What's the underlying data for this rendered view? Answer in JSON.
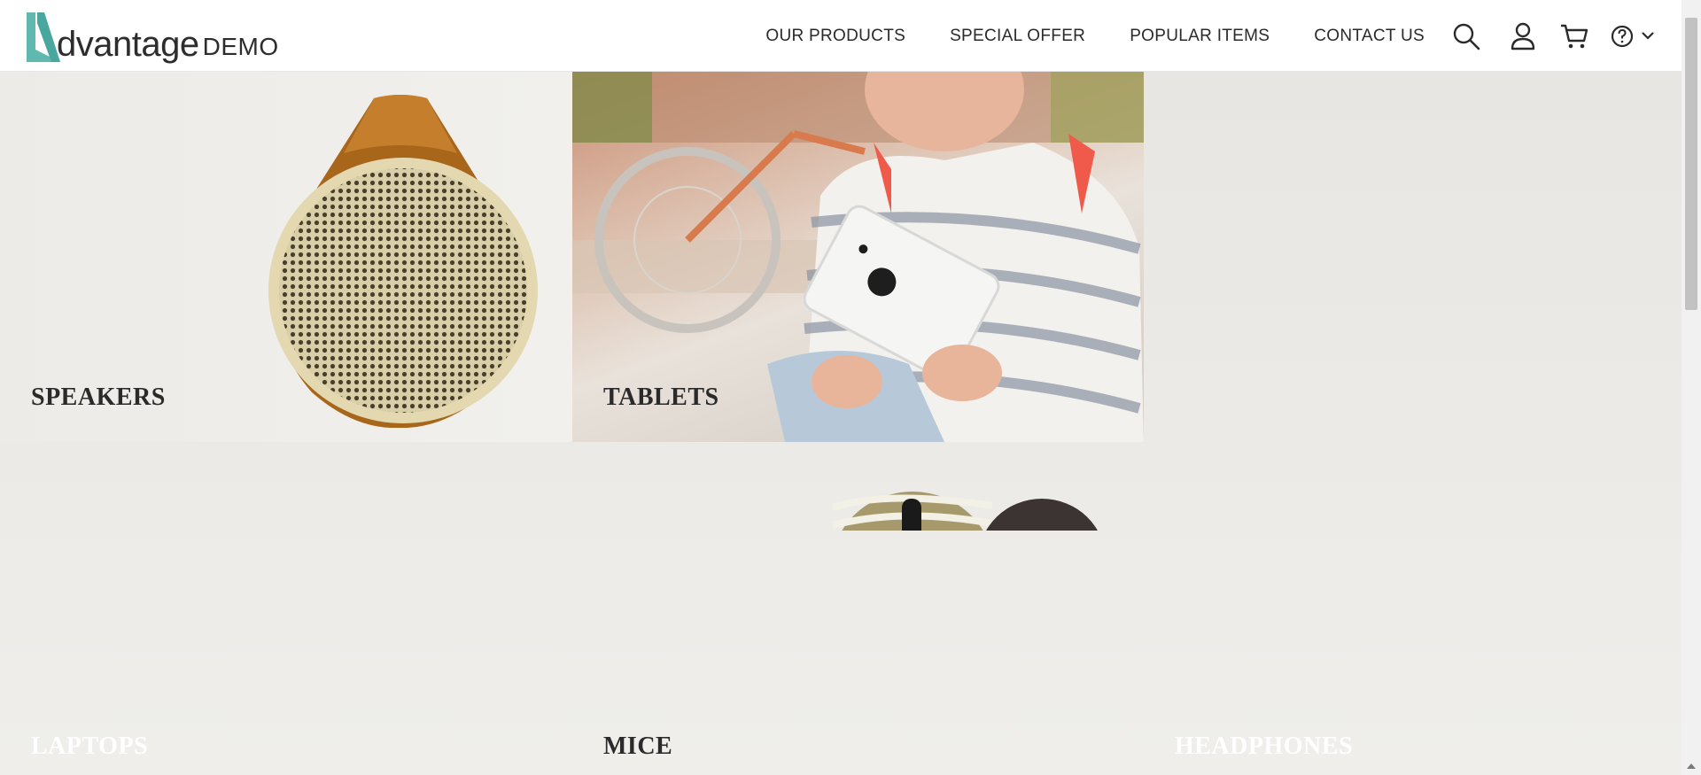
{
  "brand": {
    "logo_main": "dvantage",
    "logo_sub": "DEMO",
    "accent": "#5fb9b0"
  },
  "nav": {
    "items": [
      {
        "label": "OUR PRODUCTS"
      },
      {
        "label": "SPECIAL OFFER"
      },
      {
        "label": "POPULAR ITEMS"
      },
      {
        "label": "CONTACT US"
      }
    ]
  },
  "header_icons": [
    "search-icon",
    "user-icon",
    "cart-icon",
    "help-icon",
    "chevron-down-icon"
  ],
  "categories": [
    {
      "label": "SPEAKERS"
    },
    {
      "label": "TABLETS"
    },
    {
      "label": "LAPTOPS"
    },
    {
      "label": "MICE"
    },
    {
      "label": "HEADPHONES"
    }
  ]
}
